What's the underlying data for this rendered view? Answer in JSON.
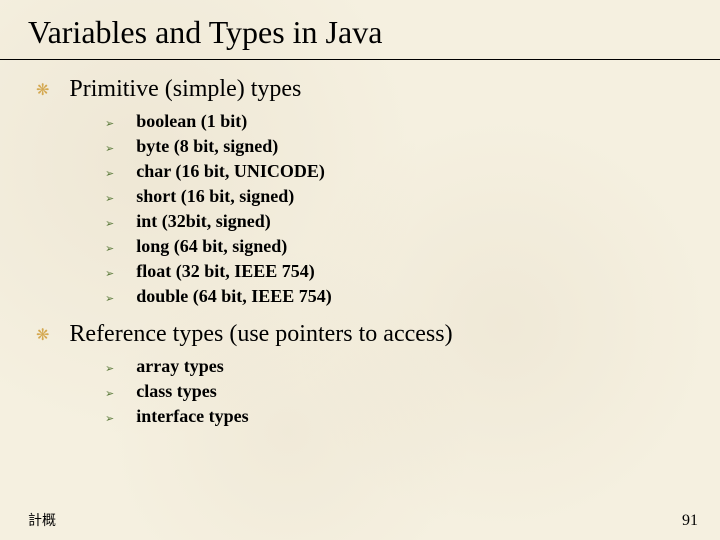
{
  "title": "Variables  and Types in Java",
  "sections": [
    {
      "heading": "Primitive (simple) types",
      "items": [
        "boolean (1 bit)",
        "byte (8 bit, signed)",
        "char (16 bit, UNICODE)",
        "short (16 bit, signed)",
        "int (32bit, signed)",
        "long (64 bit, signed)",
        "float (32 bit, IEEE 754)",
        "double (64 bit, IEEE 754)"
      ]
    },
    {
      "heading": "Reference types (use pointers to access)",
      "items": [
        "array types",
        "class types",
        "interface types"
      ]
    }
  ],
  "footer": {
    "left": "計概",
    "right": "91"
  },
  "bullets": {
    "level1": "❋",
    "level2": "➢"
  }
}
